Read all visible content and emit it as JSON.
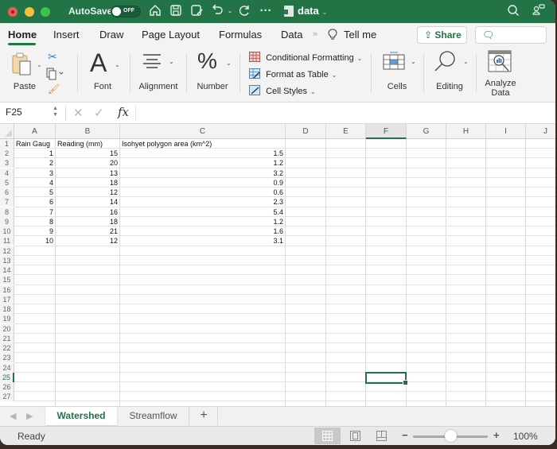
{
  "titlebar": {
    "autosave_label": "AutoSave",
    "autosave_state": "OFF",
    "document_name": "data",
    "icons": [
      "home-icon",
      "save-icon",
      "save-as-icon",
      "undo-icon",
      "redo-icon",
      "more-icon",
      "search-icon",
      "collaborate-icon"
    ]
  },
  "ribbon_tabs": [
    {
      "label": "Home",
      "active": true
    },
    {
      "label": "Insert"
    },
    {
      "label": "Draw"
    },
    {
      "label": "Page Layout"
    },
    {
      "label": "Formulas"
    },
    {
      "label": "Data"
    },
    {
      "label": "Tell me"
    }
  ],
  "more_tabs_glyph": "»",
  "share_label": "Share",
  "comments_label": "Comments",
  "ribbon": {
    "paste": "Paste",
    "font": "Font",
    "alignment": "Alignment",
    "number": "Number",
    "conditional_formatting": "Conditional Formatting",
    "format_as_table": "Format as Table",
    "cell_styles": "Cell Styles",
    "cells": "Cells",
    "editing": "Editing",
    "analyze_line1": "Analyze",
    "analyze_line2": "Data"
  },
  "formula_bar": {
    "name_box": "F25",
    "fx": "fx",
    "formula": ""
  },
  "columns": [
    "A",
    "B",
    "C",
    "D",
    "E",
    "F",
    "G",
    "H",
    "I",
    "J"
  ],
  "selected_column": "F",
  "selected_row": 25,
  "selected_cell": "F25",
  "row_numbers": [
    1,
    2,
    3,
    4,
    5,
    6,
    7,
    8,
    9,
    10,
    11,
    12,
    13,
    14,
    15,
    16,
    17,
    18,
    19,
    20,
    21,
    22,
    23,
    24,
    25,
    26,
    27
  ],
  "table": {
    "headers": [
      "Rain Gaug",
      "Reading (mm)",
      "Isohyet polygon area (km^2)"
    ],
    "rows": [
      [
        "1",
        "15",
        "1.5"
      ],
      [
        "2",
        "20",
        "1.2"
      ],
      [
        "3",
        "13",
        "3.2"
      ],
      [
        "4",
        "18",
        "0.9"
      ],
      [
        "5",
        "12",
        "0.6"
      ],
      [
        "6",
        "14",
        "2.3"
      ],
      [
        "7",
        "16",
        "5.4"
      ],
      [
        "8",
        "18",
        "1.2"
      ],
      [
        "9",
        "21",
        "1.6"
      ],
      [
        "10",
        "12",
        "3.1"
      ]
    ]
  },
  "sheets": [
    {
      "name": "Watershed",
      "active": true
    },
    {
      "name": "Streamflow",
      "active": false
    }
  ],
  "add_sheet": "+",
  "status": {
    "text": "Ready",
    "zoom_level": "100%",
    "zoom_percent": 100
  },
  "colors": {
    "accent": "#227447",
    "selection": "#217346"
  }
}
